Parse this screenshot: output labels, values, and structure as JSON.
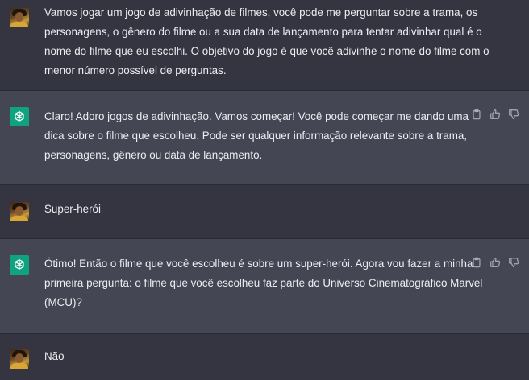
{
  "messages": [
    {
      "role": "user",
      "lines": [
        "Vamos jogar um jogo de adivinhação de filmes, você pode me perguntar sobre a trama, os",
        "personagens, o gênero do filme ou a sua data de lançamento para tentar adivinhar qual é o",
        "nome do filme que eu escolhi. O objetivo do jogo é que você adivinhe o nome do filme com o",
        "menor número possível de perguntas."
      ]
    },
    {
      "role": "assistant",
      "lines": [
        "Claro! Adoro jogos de adivinhação. Vamos começar! Você pode começar me dando uma",
        "dica sobre o filme que escolheu. Pode ser qualquer informação relevante sobre a trama,",
        "personagens, gênero ou data de lançamento."
      ]
    },
    {
      "role": "user",
      "lines": [
        "Super-herói"
      ]
    },
    {
      "role": "assistant",
      "lines": [
        "Ótimo! Então o filme que você escolheu é sobre um super-herói. Agora vou fazer a minha",
        "primeira pergunta: o filme que você escolheu faz parte do Universo Cinematográfico Marvel",
        "(MCU)?"
      ]
    },
    {
      "role": "user",
      "lines": [
        "Não"
      ]
    }
  ],
  "icons": {
    "assistant_avatar": "openai-logo-icon",
    "copy": "clipboard-icon",
    "like": "thumbs-up-icon",
    "dislike": "thumbs-down-icon"
  },
  "colors": {
    "user_bg": "#343541",
    "assistant_bg": "#444654",
    "brand_green": "#10a37f",
    "text": "#ececf1",
    "icon": "#acacbe"
  }
}
